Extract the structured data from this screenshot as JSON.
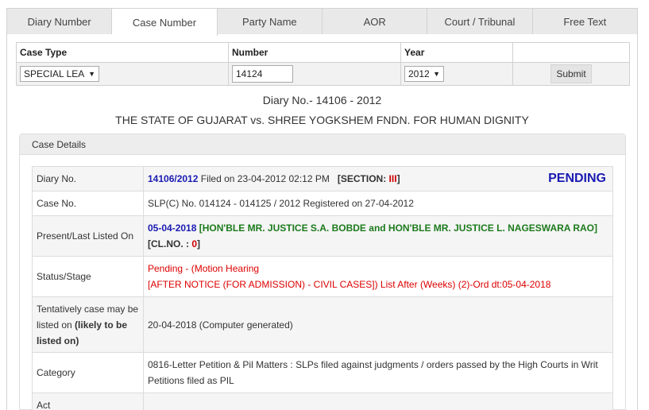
{
  "tabs": [
    "Diary Number",
    "Case Number",
    "Party Name",
    "AOR",
    "Court / Tribunal",
    "Free Text"
  ],
  "search_form": {
    "headers": {
      "case_type": "Case Type",
      "number": "Number",
      "year": "Year"
    },
    "case_type_value": "SPECIAL LEA",
    "number_value": "14124",
    "year_value": "2012",
    "submit_label": "Submit"
  },
  "diary_title": "Diary No.- 14106 - 2012",
  "parties": "THE STATE OF GUJARAT vs. SHREE YOGKSHEM FNDN. FOR HUMAN DIGNITY",
  "details_header": "Case Details",
  "details": {
    "diary_label": "Diary No.",
    "diary_number": "14106/2012",
    "diary_filed": " Filed on 23-04-2012 02:12 PM",
    "section_prefix": "[SECTION: ",
    "section_value": "III",
    "section_suffix": "]",
    "status_badge": "PENDING",
    "case_label": "Case No.",
    "case_value": "SLP(C) No. 014124 - 014125 / 2012  Registered on 27-04-2012",
    "listed_label": "Present/Last Listed On",
    "listed_date": "05-04-2018",
    "listed_bench": "[HON'BLE MR. JUSTICE S.A. BOBDE and HON'BLE MR. JUSTICE L. NAGESWARA RAO]",
    "clno_prefix": "[CL.NO. : ",
    "clno_value": "0",
    "clno_suffix": "]",
    "status_label": "Status/Stage",
    "status_line1": "Pending - (Motion Hearing",
    "status_line2": "[AFTER NOTICE (FOR ADMISSION) - CIVIL CASES]) List After (Weeks) (2)-Ord dt:05-04-2018",
    "tentative_label_1": "Tentatively case may be listed on ",
    "tentative_label_bold": "(likely to be listed on)",
    "tentative_value": "20-04-2018 (Computer generated)",
    "category_label": "Category",
    "category_value": "0816-Letter Petition & Pil Matters : SLPs filed against judgments / orders passed by the High Courts in Writ Petitions filed as PIL",
    "act_label": "Act"
  }
}
